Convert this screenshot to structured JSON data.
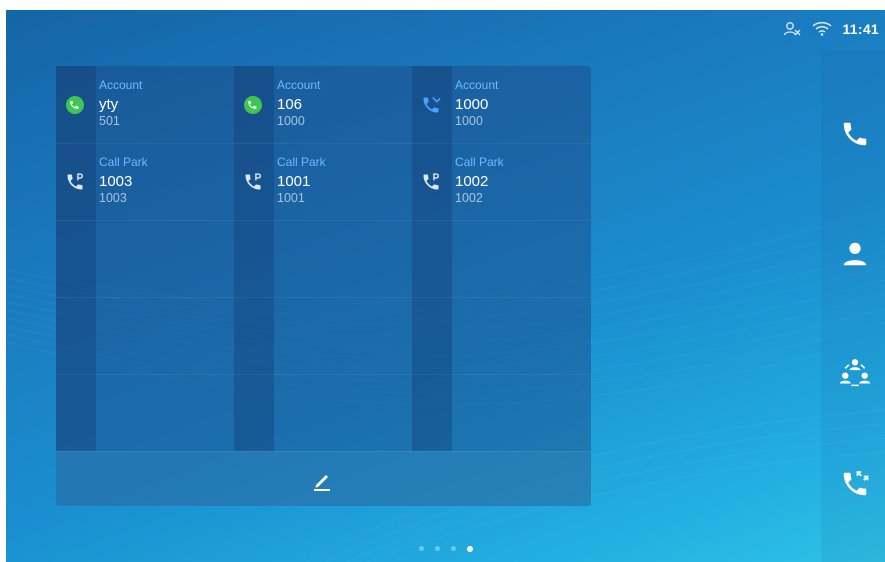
{
  "status": {
    "time": "11:41",
    "icons": [
      "account-offline-icon",
      "wifi-icon"
    ]
  },
  "dock": {
    "items": [
      "phone-icon",
      "contacts-icon",
      "conference-icon",
      "call-history-icon"
    ]
  },
  "tiles": [
    {
      "label": "Account",
      "name": "yty",
      "number": "501",
      "icon": "account-registered-icon"
    },
    {
      "label": "Account",
      "name": "106",
      "number": "1000",
      "icon": "account-registered-icon"
    },
    {
      "label": "Account",
      "name": "1000",
      "number": "1000",
      "icon": "missed-call-icon"
    },
    {
      "label": "Call Park",
      "name": "1003",
      "number": "1003",
      "icon": "call-park-icon"
    },
    {
      "label": "Call Park",
      "name": "1001",
      "number": "1001",
      "icon": "call-park-icon"
    },
    {
      "label": "Call Park",
      "name": "1002",
      "number": "1002",
      "icon": "call-park-icon"
    }
  ],
  "panel": {
    "footer_icon": "edit-icon"
  },
  "pager": {
    "count": 4,
    "active_index": 3
  }
}
